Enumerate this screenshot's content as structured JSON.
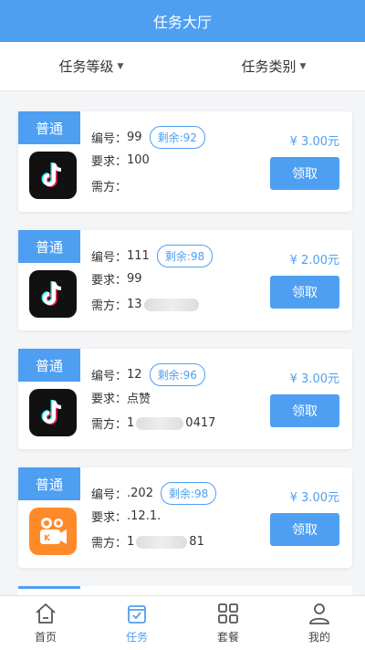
{
  "header": {
    "title": "任务大厅"
  },
  "filters": [
    {
      "label": "任务等级"
    },
    {
      "label": "任务类别"
    }
  ],
  "tasks": [
    {
      "tag": "普通",
      "app": "douyin",
      "id_label": "编号：",
      "id": "99",
      "remain_label": "剩余:",
      "remain": "92",
      "req_label": "要求：",
      "req": "100",
      "owner_label": "需方：",
      "owner_prefix": "",
      "owner_suffix": "",
      "price": "¥ 3.00元",
      "button": "领取"
    },
    {
      "tag": "普通",
      "app": "douyin",
      "id_label": "编号：",
      "id": "111",
      "remain_label": "剩余:",
      "remain": "98",
      "req_label": "要求：",
      "req": "99",
      "owner_label": "需方：",
      "owner_prefix": "13",
      "owner_suffix": "",
      "price": "¥ 2.00元",
      "button": "领取"
    },
    {
      "tag": "普通",
      "app": "douyin",
      "id_label": "编号：",
      "id": "12",
      "remain_label": "剩余:",
      "remain": "96",
      "req_label": "要求：",
      "req": "点赞",
      "owner_label": "需方：",
      "owner_prefix": "1",
      "owner_suffix": "0417",
      "price": "¥ 3.00元",
      "button": "领取"
    },
    {
      "tag": "普通",
      "app": "kuaishou",
      "id_label": "编号：",
      "id": ".202",
      "remain_label": "剩余:",
      "remain": "98",
      "req_label": "要求：",
      "req": ".12.1.",
      "owner_label": "需方：",
      "owner_prefix": "1",
      "owner_suffix": "81",
      "price": "¥ 3.00元",
      "button": "领取"
    }
  ],
  "tabbar": [
    {
      "label": "首页",
      "icon": "home-icon",
      "active": false
    },
    {
      "label": "任务",
      "icon": "task-icon",
      "active": true
    },
    {
      "label": "套餐",
      "icon": "grid-icon",
      "active": false
    },
    {
      "label": "我的",
      "icon": "user-icon",
      "active": false
    }
  ],
  "colors": {
    "accent": "#4e9ff1",
    "kuaishou": "#ff8a2a",
    "tiktok": "#111111"
  }
}
